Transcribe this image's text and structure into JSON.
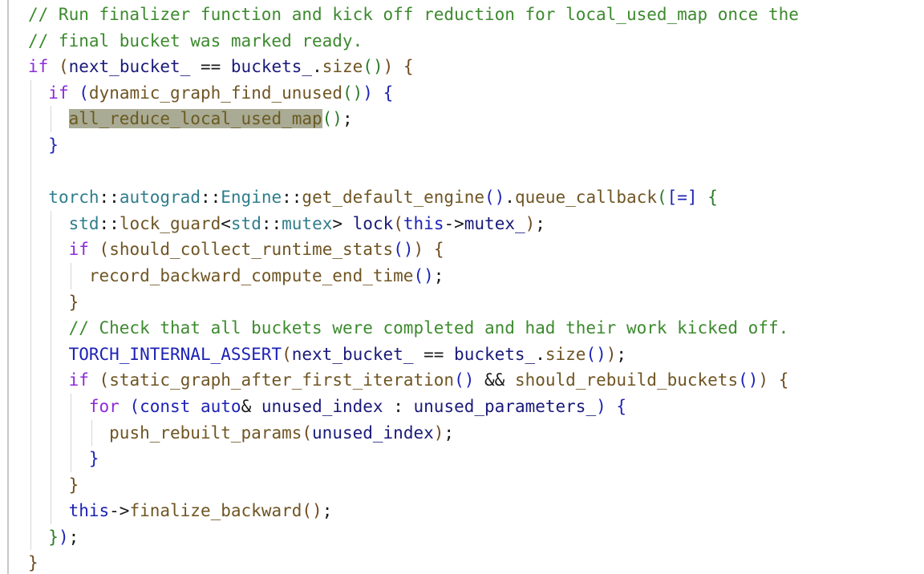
{
  "editor": {
    "language": "cpp",
    "colors": {
      "comment": "#3c8a2e",
      "keyword": "#8c2bd9",
      "function": "#6f5523",
      "identifier": "#1a1a7a",
      "namespace": "#2f7d8c",
      "highlight": "#a9ab94"
    },
    "lines": [
      {
        "indent": 0,
        "tokens": [
          {
            "t": "// Run finalizer function and kick off reduction for local_used_map once the",
            "c": "c-comment"
          }
        ]
      },
      {
        "indent": 0,
        "tokens": [
          {
            "t": "// final bucket was marked ready.",
            "c": "c-comment"
          }
        ]
      },
      {
        "indent": 0,
        "tokens": [
          {
            "t": "if",
            "c": "c-kw"
          },
          {
            "t": " ",
            "c": "c-op"
          },
          {
            "t": "(",
            "c": "c-b1"
          },
          {
            "t": "next_bucket_",
            "c": "c-ident"
          },
          {
            "t": " == ",
            "c": "c-op"
          },
          {
            "t": "buckets_",
            "c": "c-ident"
          },
          {
            "t": ".",
            "c": "c-op"
          },
          {
            "t": "size",
            "c": "c-fn"
          },
          {
            "t": "()",
            "c": "c-b2"
          },
          {
            "t": ")",
            "c": "c-b1"
          },
          {
            "t": " ",
            "c": "c-op"
          },
          {
            "t": "{",
            "c": "c-b1"
          }
        ]
      },
      {
        "indent": 1,
        "tokens": [
          {
            "t": "if",
            "c": "c-kw"
          },
          {
            "t": " ",
            "c": "c-op"
          },
          {
            "t": "(",
            "c": "c-b3"
          },
          {
            "t": "dynamic_graph_find_unused",
            "c": "c-fn"
          },
          {
            "t": "()",
            "c": "c-b2"
          },
          {
            "t": ")",
            "c": "c-b3"
          },
          {
            "t": " ",
            "c": "c-op"
          },
          {
            "t": "{",
            "c": "c-b3"
          }
        ]
      },
      {
        "indent": 2,
        "tokens": [
          {
            "t": "all_reduce_local_used_map",
            "c": "c-fn hl"
          },
          {
            "t": "()",
            "c": "c-b2"
          },
          {
            "t": ";",
            "c": "c-op"
          }
        ]
      },
      {
        "indent": 1,
        "tokens": [
          {
            "t": "}",
            "c": "c-b3"
          }
        ]
      },
      {
        "indent": 1,
        "tokens": []
      },
      {
        "indent": 1,
        "tokens": [
          {
            "t": "torch",
            "c": "c-ns"
          },
          {
            "t": "::",
            "c": "c-op"
          },
          {
            "t": "autograd",
            "c": "c-ns"
          },
          {
            "t": "::",
            "c": "c-op"
          },
          {
            "t": "Engine",
            "c": "c-ns"
          },
          {
            "t": "::",
            "c": "c-op"
          },
          {
            "t": "get_default_engine",
            "c": "c-fn"
          },
          {
            "t": "()",
            "c": "c-b3"
          },
          {
            "t": ".",
            "c": "c-op"
          },
          {
            "t": "queue_callback",
            "c": "c-fn"
          },
          {
            "t": "(",
            "c": "c-b2"
          },
          {
            "t": "[=]",
            "c": "c-b3"
          },
          {
            "t": " ",
            "c": "c-op"
          },
          {
            "t": "{",
            "c": "c-b2"
          }
        ]
      },
      {
        "indent": 2,
        "tokens": [
          {
            "t": "std",
            "c": "c-ns"
          },
          {
            "t": "::",
            "c": "c-op"
          },
          {
            "t": "lock_guard",
            "c": "c-fn"
          },
          {
            "t": "<",
            "c": "c-op"
          },
          {
            "t": "std",
            "c": "c-ns"
          },
          {
            "t": "::",
            "c": "c-op"
          },
          {
            "t": "mutex",
            "c": "c-type"
          },
          {
            "t": "> ",
            "c": "c-op"
          },
          {
            "t": "lock",
            "c": "c-ident"
          },
          {
            "t": "(",
            "c": "c-b1"
          },
          {
            "t": "this",
            "c": "c-kw2"
          },
          {
            "t": "->",
            "c": "c-op"
          },
          {
            "t": "mutex_",
            "c": "c-ident"
          },
          {
            "t": ")",
            "c": "c-b1"
          },
          {
            "t": ";",
            "c": "c-op"
          }
        ]
      },
      {
        "indent": 2,
        "tokens": [
          {
            "t": "if",
            "c": "c-kw"
          },
          {
            "t": " ",
            "c": "c-op"
          },
          {
            "t": "(",
            "c": "c-b1"
          },
          {
            "t": "should_collect_runtime_stats",
            "c": "c-fn"
          },
          {
            "t": "()",
            "c": "c-b3"
          },
          {
            "t": ")",
            "c": "c-b1"
          },
          {
            "t": " ",
            "c": "c-op"
          },
          {
            "t": "{",
            "c": "c-b1"
          }
        ]
      },
      {
        "indent": 3,
        "tokens": [
          {
            "t": "record_backward_compute_end_time",
            "c": "c-fn"
          },
          {
            "t": "()",
            "c": "c-b3"
          },
          {
            "t": ";",
            "c": "c-op"
          }
        ]
      },
      {
        "indent": 2,
        "tokens": [
          {
            "t": "}",
            "c": "c-b1"
          }
        ]
      },
      {
        "indent": 2,
        "tokens": [
          {
            "t": "// Check that all buckets were completed and had their work kicked off.",
            "c": "c-comment"
          }
        ]
      },
      {
        "indent": 2,
        "tokens": [
          {
            "t": "TORCH_INTERNAL_ASSERT",
            "c": "c-macro"
          },
          {
            "t": "(",
            "c": "c-b1"
          },
          {
            "t": "next_bucket_",
            "c": "c-ident"
          },
          {
            "t": " == ",
            "c": "c-op"
          },
          {
            "t": "buckets_",
            "c": "c-ident"
          },
          {
            "t": ".",
            "c": "c-op"
          },
          {
            "t": "size",
            "c": "c-fn"
          },
          {
            "t": "()",
            "c": "c-b3"
          },
          {
            "t": ")",
            "c": "c-b1"
          },
          {
            "t": ";",
            "c": "c-op"
          }
        ]
      },
      {
        "indent": 2,
        "tokens": [
          {
            "t": "if",
            "c": "c-kw"
          },
          {
            "t": " ",
            "c": "c-op"
          },
          {
            "t": "(",
            "c": "c-b1"
          },
          {
            "t": "static_graph_after_first_iteration",
            "c": "c-fn"
          },
          {
            "t": "()",
            "c": "c-b3"
          },
          {
            "t": " && ",
            "c": "c-op"
          },
          {
            "t": "should_rebuild_buckets",
            "c": "c-fn"
          },
          {
            "t": "()",
            "c": "c-b3"
          },
          {
            "t": ")",
            "c": "c-b1"
          },
          {
            "t": " ",
            "c": "c-op"
          },
          {
            "t": "{",
            "c": "c-b1"
          }
        ]
      },
      {
        "indent": 3,
        "tokens": [
          {
            "t": "for",
            "c": "c-kw"
          },
          {
            "t": " ",
            "c": "c-op"
          },
          {
            "t": "(",
            "c": "c-b3"
          },
          {
            "t": "const",
            "c": "c-kw2"
          },
          {
            "t": " ",
            "c": "c-op"
          },
          {
            "t": "auto",
            "c": "c-kw2"
          },
          {
            "t": "& ",
            "c": "c-op"
          },
          {
            "t": "unused_index",
            "c": "c-ident"
          },
          {
            "t": " : ",
            "c": "c-op"
          },
          {
            "t": "unused_parameters_",
            "c": "c-ident"
          },
          {
            "t": ")",
            "c": "c-b3"
          },
          {
            "t": " ",
            "c": "c-op"
          },
          {
            "t": "{",
            "c": "c-b3"
          }
        ]
      },
      {
        "indent": 4,
        "tokens": [
          {
            "t": "push_rebuilt_params",
            "c": "c-fn"
          },
          {
            "t": "(",
            "c": "c-b1"
          },
          {
            "t": "unused_index",
            "c": "c-ident"
          },
          {
            "t": ")",
            "c": "c-b1"
          },
          {
            "t": ";",
            "c": "c-op"
          }
        ]
      },
      {
        "indent": 3,
        "tokens": [
          {
            "t": "}",
            "c": "c-b3"
          }
        ]
      },
      {
        "indent": 2,
        "tokens": [
          {
            "t": "}",
            "c": "c-b1"
          }
        ]
      },
      {
        "indent": 2,
        "tokens": [
          {
            "t": "this",
            "c": "c-kw2"
          },
          {
            "t": "->",
            "c": "c-op"
          },
          {
            "t": "finalize_backward",
            "c": "c-fn"
          },
          {
            "t": "()",
            "c": "c-b1"
          },
          {
            "t": ";",
            "c": "c-op"
          }
        ]
      },
      {
        "indent": 1,
        "tokens": [
          {
            "t": "}",
            "c": "c-b2"
          },
          {
            "t": ")",
            "c": "c-b3"
          },
          {
            "t": ";",
            "c": "c-op"
          }
        ]
      },
      {
        "indent": 0,
        "tokens": [
          {
            "t": "}",
            "c": "c-b1"
          }
        ]
      }
    ]
  }
}
